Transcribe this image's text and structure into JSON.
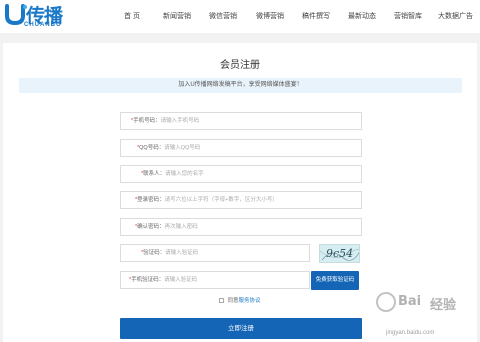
{
  "header": {
    "logo_cn": "传播",
    "logo_en": "CHUANBO",
    "nav": [
      "首 页",
      "新闻营销",
      "微信营销",
      "微博营销",
      "稿件撰写",
      "最新动态",
      "营销智库",
      "大数据广告"
    ]
  },
  "page": {
    "title": "会员注册",
    "notice": "加入U传播网络发稿平台，享受网络媒体盛宴！"
  },
  "form": {
    "fields": [
      {
        "label": "手机号码：",
        "placeholder": "请输入手机号码"
      },
      {
        "label": "QQ号码：",
        "placeholder": "请输入QQ号码"
      },
      {
        "label": "联系人：",
        "placeholder": "请输入您的名字"
      },
      {
        "label": "登录密码：",
        "placeholder": "请写六位以上字符（字母+数字，区分大小写）"
      },
      {
        "label": "确认密码：",
        "placeholder": "再次输入密码"
      },
      {
        "label": "验证码：",
        "placeholder": "请输入验证码"
      },
      {
        "label": "手机验证码：",
        "placeholder": "请输入验证码"
      }
    ],
    "required_mark": "*",
    "captcha_text": "9c54",
    "sms_button": "免费获取验证码",
    "agree_prefix": "同意",
    "agree_link": "服务协议",
    "submit_label": "立即注册"
  },
  "watermark": {
    "text1": "Bai",
    "text2": "经验",
    "url": "jingyan.baidu.com"
  },
  "colors": {
    "brand_blue": "#1565b6",
    "notice_bg": "#e8f3fb",
    "required_red": "#ee3333"
  }
}
